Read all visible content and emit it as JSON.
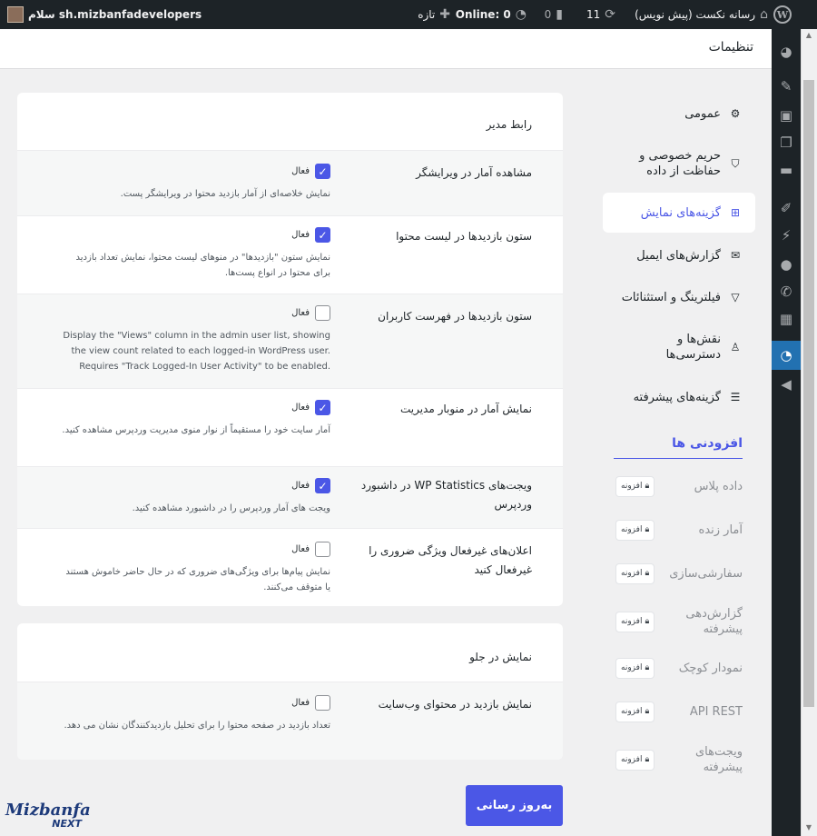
{
  "adminbar": {
    "greeting": "سلام sh.mizbanfadevelopers",
    "online": "Online: 0",
    "new_label": "تازه",
    "comments_count": "0",
    "updates_count": "11",
    "site_name": "رسانه نکست (پیش نویس)"
  },
  "page": {
    "title": "تنظیمات"
  },
  "nav": {
    "items": [
      {
        "label": "عمومی",
        "icon": "gear-icon"
      },
      {
        "label": "حریم خصوصی و حفاظت از داده",
        "icon": "shield-icon"
      },
      {
        "label": "گزینه‌های نمایش",
        "icon": "grid-icon",
        "active": true
      },
      {
        "label": "گزارش‌های ایمیل",
        "icon": "mail-icon"
      },
      {
        "label": "فیلترینگ و استثنائات",
        "icon": "filter-icon"
      },
      {
        "label": "نقش‌ها و دسترسی‌ها",
        "icon": "user-key-icon"
      },
      {
        "label": "گزینه‌های پیشرفته",
        "icon": "sliders-icon"
      }
    ],
    "addons_heading": "افزودنی ها",
    "addons": [
      {
        "label": "داده پلاس",
        "badge": "افزونه"
      },
      {
        "label": "آمار زنده",
        "badge": "افزونه"
      },
      {
        "label": "سفارشی‌سازی",
        "badge": "افزونه"
      },
      {
        "label": "گزارش‌دهی پیشرفته",
        "badge": "افزونه"
      },
      {
        "label": "نمودار کوچک",
        "badge": "افزونه"
      },
      {
        "label": "API REST",
        "badge": "افزونه"
      },
      {
        "label": "ویجت‌های پیشرفته",
        "badge": "افزونه"
      }
    ]
  },
  "admin_card": {
    "title": "رابط مدیر",
    "rows": [
      {
        "label": "مشاهده آمار در ویرایشگر",
        "checked": true,
        "checkbox_label": "فعال",
        "desc": "نمایش خلاصه‌ای از آمار بازدید محتوا در ویرایشگر پست."
      },
      {
        "label": "ستون بازدیدها در لیست محتوا",
        "checked": true,
        "checkbox_label": "فعال",
        "desc": "نمایش ستون \"بازدیدها\" در منوهای لیست محتوا، نمایش تعداد بازدید برای محتوا در انواع پست‌ها."
      },
      {
        "label": "ستون بازدیدها در فهرست کاربران",
        "checked": false,
        "checkbox_label": "فعال",
        "desc": "Display the \"Views\" column in the admin user list, showing the view count related to each logged-in WordPress user. Requires \"Track Logged-In User Activity\" to be enabled."
      },
      {
        "label": "نمایش آمار در منوبار مدیریت",
        "checked": true,
        "checkbox_label": "فعال",
        "desc": "آمار سایت خود را مستقیماً از نوار منوی مدیریت وردپرس مشاهده کنید."
      },
      {
        "label": "ویجت‌های WP Statistics در داشبورد وردپرس",
        "checked": true,
        "checkbox_label": "فعال",
        "desc": "ویجت های آمار وردپرس را در داشبورد مشاهده کنید."
      },
      {
        "label": "اعلان‌های غیرفعال ویژگی ضروری را غیرفعال کنید",
        "checked": false,
        "checkbox_label": "فعال",
        "desc": "نمایش پیام‌ها برای ویژگی‌های ضروری که در حال حاضر خاموش هستند یا متوقف می‌کنند."
      }
    ]
  },
  "front_card": {
    "title": "نمایش در جلو",
    "rows": [
      {
        "label": "نمایش بازدید در محتوای وب‌سایت",
        "checked": false,
        "checkbox_label": "فعال",
        "desc": "تعداد بازدید در صفحه محتوا را برای تحلیل بازدیدکنندگان نشان می دهد."
      }
    ]
  },
  "save_button": "به‌روز رسانی",
  "brand": {
    "line1": "Mizbanfa",
    "line2": "NEXT"
  },
  "colors": {
    "accent": "#4b57e6",
    "adminbar": "#1d2327",
    "wp_blue": "#2271b1"
  }
}
